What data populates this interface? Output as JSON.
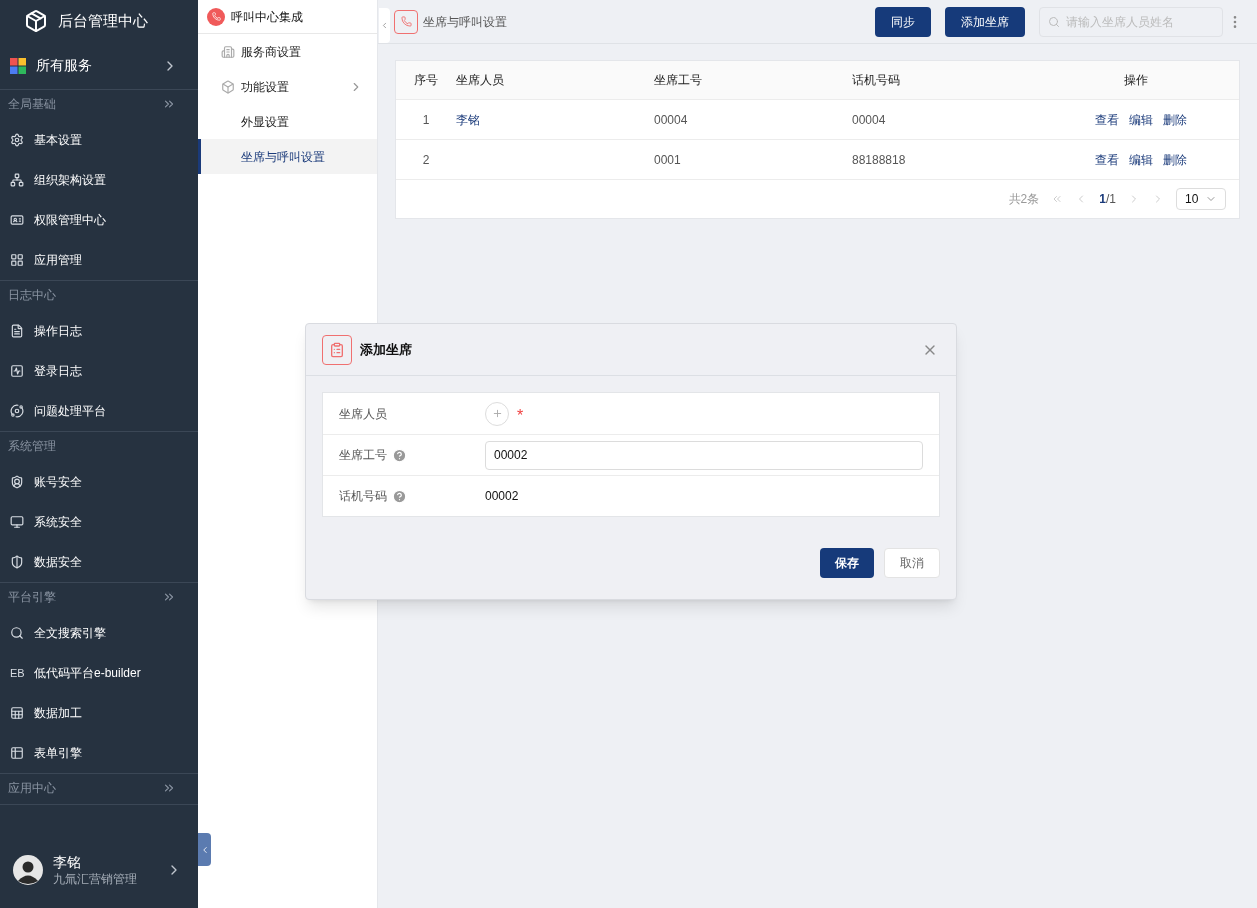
{
  "sidebar": {
    "title": "后台管理中心",
    "all_services": "所有服务",
    "groups": [
      {
        "heading": "全局基础",
        "collapsible": true,
        "items": [
          {
            "label": "基本设置"
          },
          {
            "label": "组织架构设置"
          },
          {
            "label": "权限管理中心"
          },
          {
            "label": "应用管理"
          }
        ]
      },
      {
        "heading": "日志中心",
        "collapsible": false,
        "items": [
          {
            "label": "操作日志"
          },
          {
            "label": "登录日志"
          },
          {
            "label": "问题处理平台"
          }
        ]
      },
      {
        "heading": "系统管理",
        "collapsible": false,
        "items": [
          {
            "label": "账号安全"
          },
          {
            "label": "系统安全"
          },
          {
            "label": "数据安全"
          }
        ]
      },
      {
        "heading": "平台引擎",
        "collapsible": true,
        "items": [
          {
            "label": "全文搜索引擎"
          },
          {
            "label": "低代码平台e-builder",
            "badge": "EB"
          },
          {
            "label": "数据加工"
          },
          {
            "label": "表单引擎"
          }
        ]
      },
      {
        "heading": "应用中心",
        "collapsible": true
      }
    ],
    "user": {
      "name": "李铭",
      "org": "九氚汇营销管理"
    }
  },
  "submenu": {
    "title": "呼叫中心集成",
    "items": [
      {
        "label": "服务商设置",
        "selected": false,
        "has_children": false,
        "child": false
      },
      {
        "label": "功能设置",
        "selected": false,
        "has_children": true,
        "child": false
      },
      {
        "label": "外显设置",
        "selected": false,
        "has_children": false,
        "child": true
      },
      {
        "label": "坐席与呼叫设置",
        "selected": true,
        "has_children": false,
        "child": true
      }
    ]
  },
  "toolbar": {
    "breadcrumb": "坐席与呼叫设置",
    "buttons": [
      "同步",
      "添加坐席"
    ],
    "search": {
      "placeholder": "请输入坐席人员姓名"
    }
  },
  "table": {
    "columns": [
      "序号",
      "坐席人员",
      "坐席工号",
      "话机号码",
      "操作"
    ],
    "rows": [
      {
        "index": "1",
        "agent": "李铭",
        "agent_id": "00004",
        "phone": "00004",
        "actions": [
          "查看",
          "编辑",
          "删除"
        ]
      },
      {
        "index": "2",
        "agent_id": "0001",
        "phone": "88188818",
        "actions": [
          "查看",
          "编辑",
          "删除"
        ]
      }
    ],
    "pager": {
      "total": "共2条",
      "current": "1",
      "pages": "/1",
      "page_size": "10"
    }
  },
  "dialog": {
    "title": "添加坐席",
    "fields": [
      {
        "kind": "picker",
        "label": "坐席人员",
        "help": false,
        "required_mark": "*"
      },
      {
        "kind": "input",
        "label": "坐席工号",
        "help": true,
        "value": "00002"
      },
      {
        "kind": "text",
        "label": "话机号码",
        "help": true,
        "value": "00002"
      }
    ],
    "buttons": [
      {
        "label": "保存",
        "primary": true
      },
      {
        "label": "取消",
        "primary": false
      }
    ]
  }
}
